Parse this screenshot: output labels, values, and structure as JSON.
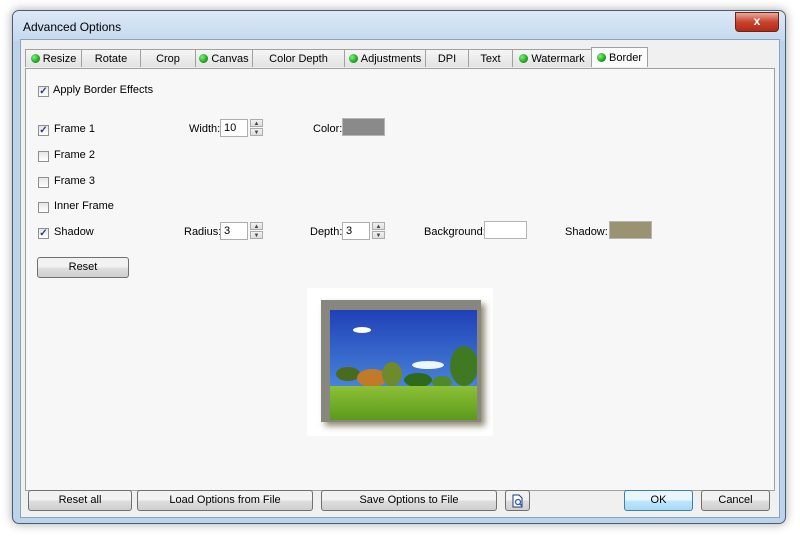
{
  "window": {
    "title": "Advanced Options",
    "close_glyph": "x"
  },
  "tabs": [
    {
      "label": "Resize",
      "status": true
    },
    {
      "label": "Rotate",
      "status": false
    },
    {
      "label": "Crop",
      "status": false
    },
    {
      "label": "Canvas",
      "status": true
    },
    {
      "label": "Color Depth",
      "status": false
    },
    {
      "label": "Adjustments",
      "status": true
    },
    {
      "label": "DPI",
      "status": false
    },
    {
      "label": "Text",
      "status": false
    },
    {
      "label": "Watermark",
      "status": true
    },
    {
      "label": "Border",
      "status": true
    }
  ],
  "active_tab": "Border",
  "border": {
    "apply": {
      "label": "Apply Border Effects",
      "checked": true
    },
    "frame1": {
      "label": "Frame 1",
      "checked": true,
      "width_label": "Width:",
      "width_value": "10",
      "color_label": "Color:",
      "color": "#8a8a8a"
    },
    "frame2": {
      "label": "Frame 2",
      "checked": false
    },
    "frame3": {
      "label": "Frame 3",
      "checked": false
    },
    "inner_frame": {
      "label": "Inner Frame",
      "checked": false
    },
    "shadow": {
      "label": "Shadow",
      "checked": true,
      "radius_label": "Radius:",
      "radius_value": "3",
      "depth_label": "Depth:",
      "depth_value": "3",
      "background_label": "Background:",
      "background_color": "#ffffff",
      "shadow_label": "Shadow:",
      "shadow_color": "#9b9370"
    },
    "reset_label": "Reset"
  },
  "footer": {
    "reset_all": "Reset all",
    "load": "Load Options from File",
    "save": "Save Options to File",
    "preview_icon": "preview-zoom-icon",
    "ok": "OK",
    "cancel": "Cancel"
  }
}
